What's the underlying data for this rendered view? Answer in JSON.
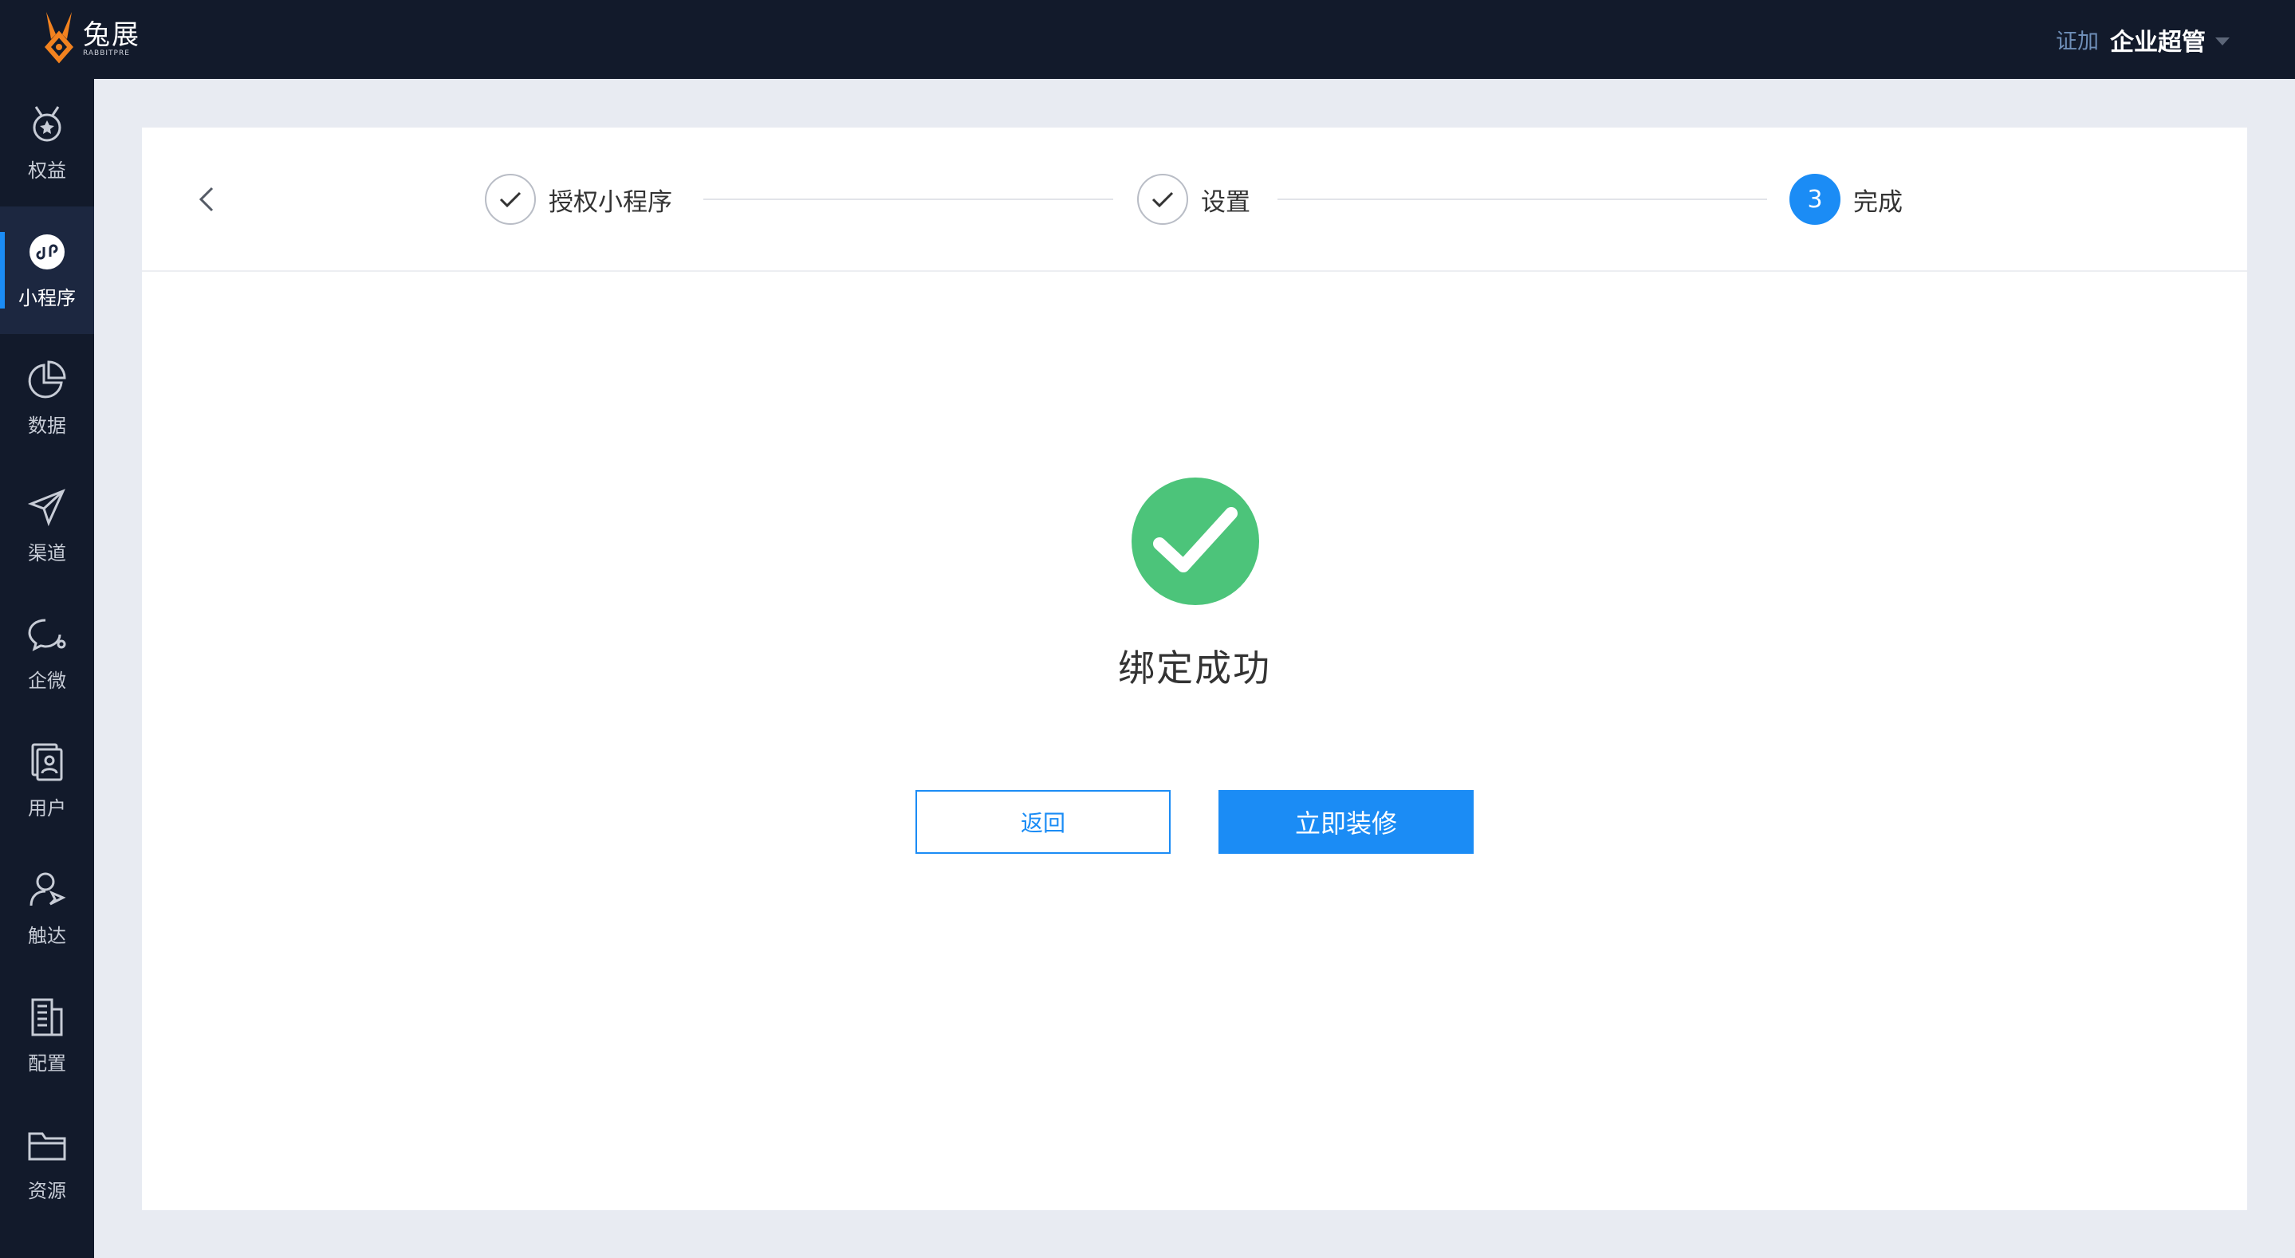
{
  "app": {
    "brand_cn": "兔展",
    "brand_en": "RABBITPRE",
    "certified_label": "证加",
    "user_name": "企业超管"
  },
  "sidebar": {
    "items": [
      {
        "label": "权益",
        "icon": "medal-icon"
      },
      {
        "label": "小程序",
        "icon": "mini-program-icon",
        "active": true
      },
      {
        "label": "数据",
        "icon": "pie-chart-icon"
      },
      {
        "label": "渠道",
        "icon": "paper-plane-icon"
      },
      {
        "label": "企微",
        "icon": "chat-bubble-icon"
      },
      {
        "label": "用户",
        "icon": "contacts-icon"
      },
      {
        "label": "触达",
        "icon": "user-send-icon"
      },
      {
        "label": "配置",
        "icon": "building-icon"
      },
      {
        "label": "资源",
        "icon": "folder-icon"
      }
    ]
  },
  "steps": [
    {
      "label": "授权小程序",
      "status": "done"
    },
    {
      "label": "设置",
      "status": "done"
    },
    {
      "number": "3",
      "label": "完成",
      "status": "current"
    }
  ],
  "result": {
    "title": "绑定成功",
    "icon": "success-check-icon",
    "success_color": "#4cc47a"
  },
  "actions": {
    "back_label": "返回",
    "decorate_label": "立即装修"
  },
  "colors": {
    "primary": "#1b8cf5",
    "nav_bg": "#121a2b"
  }
}
